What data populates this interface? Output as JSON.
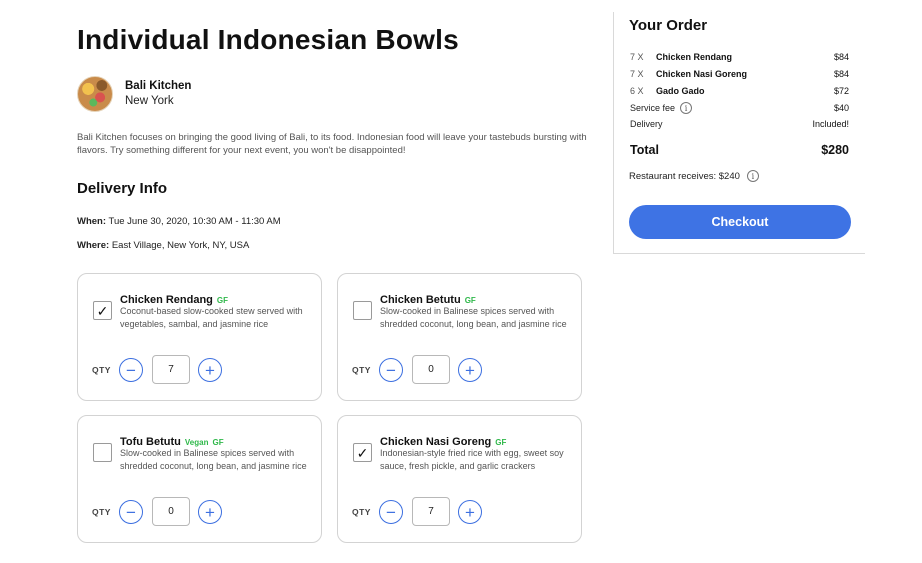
{
  "page": {
    "title": "Individual Indonesian Bowls",
    "restaurant_name": "Bali Kitchen",
    "restaurant_city": "New York",
    "description": "Bali Kitchen focuses on bringing the good living of Bali, to its food. Indonesian food will leave your tastebuds bursting with flavors. Try something different for your next event, you won't be disappointed!"
  },
  "delivery": {
    "section_title": "Delivery Info",
    "when_label": "When:",
    "when_value": "Tue June 30, 2020, 10:30 AM - 11:30 AM",
    "where_label": "Where:",
    "where_value": "East Village, New York, NY, USA"
  },
  "dishes": [
    {
      "name": "Chicken Rendang",
      "tags": [
        "GF"
      ],
      "description": "Coconut-based slow-cooked stew served with vegetables, sambal, and jasmine rice",
      "checked": true,
      "check_glyph": "✓",
      "qty_label": "QTY",
      "qty": "7",
      "minus": "−",
      "plus": "+"
    },
    {
      "name": "Chicken Betutu",
      "tags": [
        "GF"
      ],
      "description": "Slow-cooked in Balinese spices served with shredded coconut, long bean, and jasmine rice",
      "checked": false,
      "check_glyph": "",
      "qty_label": "QTY",
      "qty": "0",
      "minus": "−",
      "plus": "+"
    },
    {
      "name": "Tofu Betutu",
      "tags": [
        "Vegan",
        "GF"
      ],
      "description": "Slow-cooked in Balinese spices served with shredded coconut, long bean, and jasmine rice",
      "checked": false,
      "check_glyph": "",
      "qty_label": "QTY",
      "qty": "0",
      "minus": "−",
      "plus": "+"
    },
    {
      "name": "Chicken Nasi Goreng",
      "tags": [
        "GF"
      ],
      "description": "Indonesian-style fried rice with egg, sweet soy sauce, fresh pickle, and garlic crackers",
      "checked": true,
      "check_glyph": "✓",
      "qty_label": "QTY",
      "qty": "7",
      "minus": "−",
      "plus": "+"
    }
  ],
  "order": {
    "title": "Your Order",
    "items": [
      {
        "qty": "7 X",
        "name": "Chicken Rendang",
        "price": "$84"
      },
      {
        "qty": "7 X",
        "name": "Chicken Nasi Goreng",
        "price": "$84"
      },
      {
        "qty": "6 X",
        "name": "Gado Gado",
        "price": "$72"
      }
    ],
    "service_fee_label": "Service fee",
    "service_fee_value": "$40",
    "delivery_label": "Delivery",
    "delivery_value": "Included!",
    "total_label": "Total",
    "total_value": "$280",
    "receives_text": "Restaurant receives: $240",
    "info_glyph": "i",
    "checkout_label": "Checkout"
  },
  "colors": {
    "accent": "#3e73e4",
    "tag_green": "#2fb84a"
  }
}
